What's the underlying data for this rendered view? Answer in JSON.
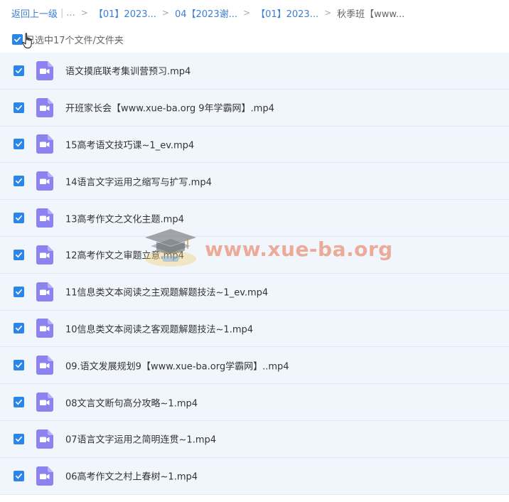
{
  "breadcrumb": {
    "back_label": "返回上一级",
    "pipe": "|",
    "ellipsis": "...",
    "separator": ">",
    "crumbs": [
      "【01】2023...",
      "04【2023谢...",
      "【01】2023..."
    ],
    "current": "秋季班【www..."
  },
  "selection": {
    "summary": "已选中17个文件/文件夹"
  },
  "files": [
    {
      "name": "语文摸底联考集训营预习.mp4"
    },
    {
      "name": "开班家长会【www.xue-ba.org 9年学霸网】.mp4"
    },
    {
      "name": "15高考语文技巧课~1_ev.mp4"
    },
    {
      "name": "14语言文字运用之缩写与扩写.mp4"
    },
    {
      "name": "13高考作文之文化主题.mp4"
    },
    {
      "name": "12高考作文之审题立意.mp4"
    },
    {
      "name": "11信息类文本阅读之主观题解题技法~1_ev.mp4"
    },
    {
      "name": "10信息类文本阅读之客观题解题技法~1.mp4"
    },
    {
      "name": "09.语文发展规划9【www.xue-ba.org学霸网】..mp4"
    },
    {
      "name": "08文言文断句高分攻略~1.mp4"
    },
    {
      "name": "07语言文字运用之简明连贯~1.mp4"
    },
    {
      "name": "06高考作文之村上春树~1.mp4"
    }
  ],
  "watermark": {
    "text": "www.xue-ba.org"
  },
  "colors": {
    "accent": "#2a86e8",
    "row_bg": "#f1f6fd",
    "video_icon": "#8b83f0"
  }
}
